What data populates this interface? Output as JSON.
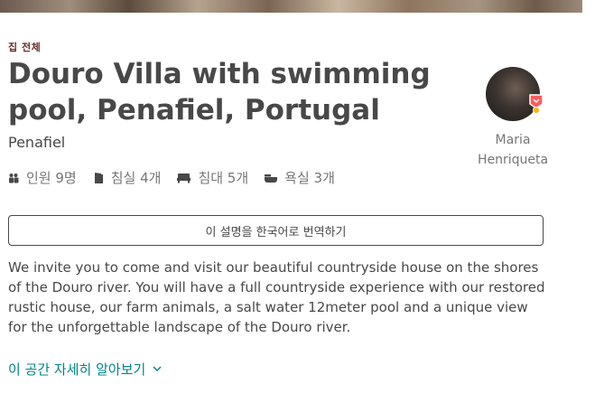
{
  "listing": {
    "type_label": "집 전체",
    "title": "Douro Villa with swimming pool, Penafiel, Portugal",
    "city": "Penafiel"
  },
  "host": {
    "name": "Maria Henriqueta"
  },
  "stats": [
    {
      "icon": "guests-icon",
      "label": "인원 9명"
    },
    {
      "icon": "bedroom-icon",
      "label": "침실 4개"
    },
    {
      "icon": "bed-icon",
      "label": "침대 5개"
    },
    {
      "icon": "bath-icon",
      "label": "욕실 3개"
    }
  ],
  "translate_button": "이 설명을 한국어로 번역하기",
  "description": "We invite you to come and visit our beautiful countryside house on the shores of the Douro river. You will have a full countryside experience with our restored rustic house, our farm animals, a salt water 12meter pool and a unique view for the unforgettable landscape of the Douro river.",
  "read_more": "이 공간 자세히 알아보기",
  "colors": {
    "text": "#484848",
    "muted": "#767676",
    "link": "#008489",
    "eyebrow": "#6b2a2a"
  }
}
